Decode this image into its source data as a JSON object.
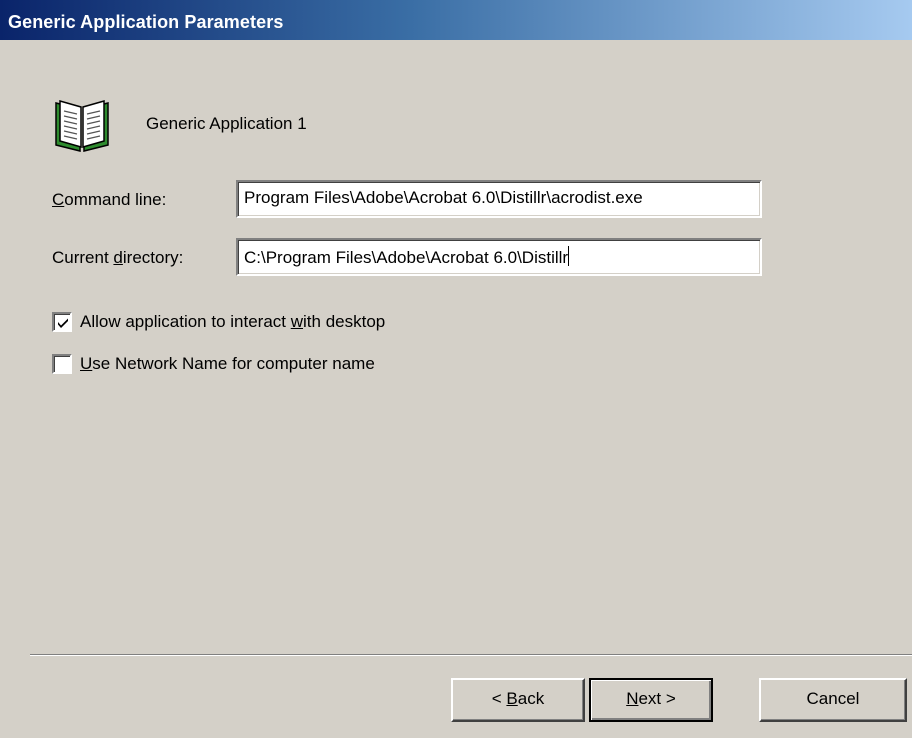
{
  "window": {
    "title": "Generic Application Parameters"
  },
  "header": {
    "icon": "open-book-icon",
    "app_name": "Generic Application 1"
  },
  "form": {
    "command_line": {
      "mnemonic": "C",
      "label_rest": "ommand line:",
      "value": "Program Files\\Adobe\\Acrobat 6.0\\Distillr\\acrodist.exe"
    },
    "current_directory": {
      "label_before": "Current ",
      "mnemonic": "d",
      "label_after": "irectory:",
      "value": "C:\\Program Files\\Adobe\\Acrobat 6.0\\Distillr"
    },
    "allow_interact": {
      "checked": true,
      "label_before": "Allow application to interact ",
      "mnemonic": "w",
      "label_after": "ith desktop"
    },
    "use_network_name": {
      "checked": false,
      "mnemonic": "U",
      "label_after": "se Network Name for computer name"
    }
  },
  "buttons": {
    "back": {
      "prefix": "< ",
      "mnemonic": "B",
      "rest": "ack"
    },
    "next": {
      "mnemonic": "N",
      "rest": "ext >"
    },
    "cancel": {
      "label": "Cancel"
    }
  },
  "colors": {
    "title_start": "#0a246a",
    "title_end": "#a6caf0",
    "dialog_bg": "#d4d0c8",
    "icon_green": "#2e8b2e"
  }
}
